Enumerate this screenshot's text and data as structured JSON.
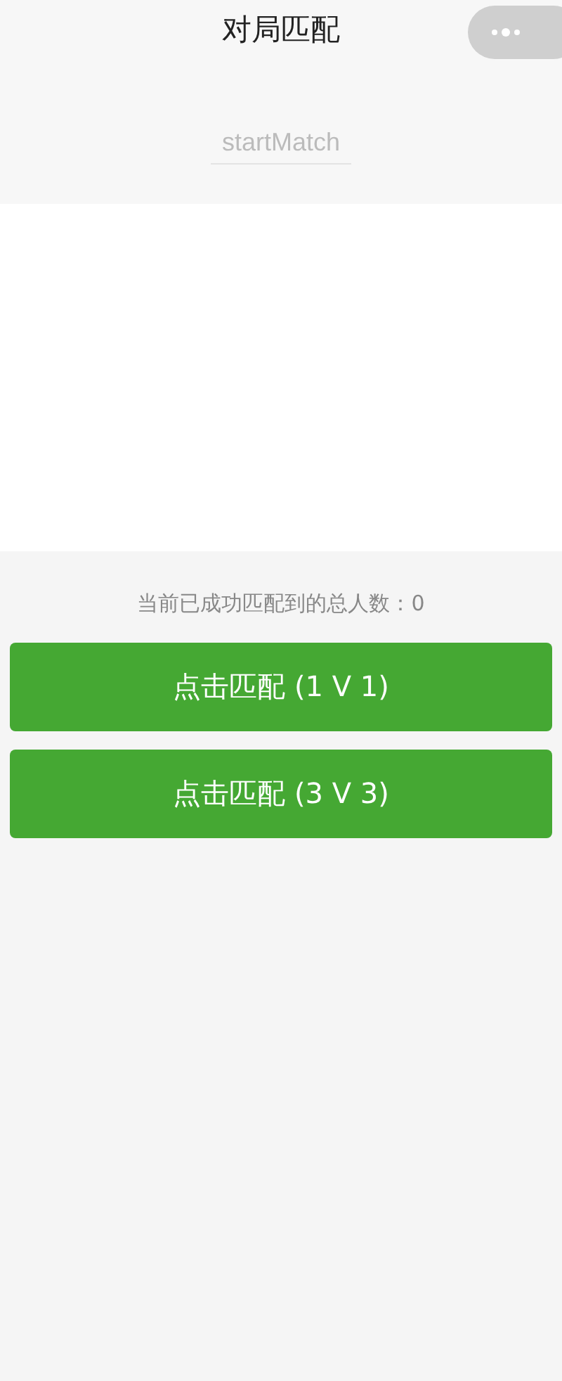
{
  "nav_bar": {
    "title": "对局匹配"
  },
  "input": {
    "placeholder": "startMatch"
  },
  "status": {
    "text": "当前已成功匹配到的总人数：0"
  },
  "buttons": [
    {
      "label": "点击匹配 (1 V 1)"
    },
    {
      "label": "点击匹配 (3 V 3)"
    }
  ]
}
